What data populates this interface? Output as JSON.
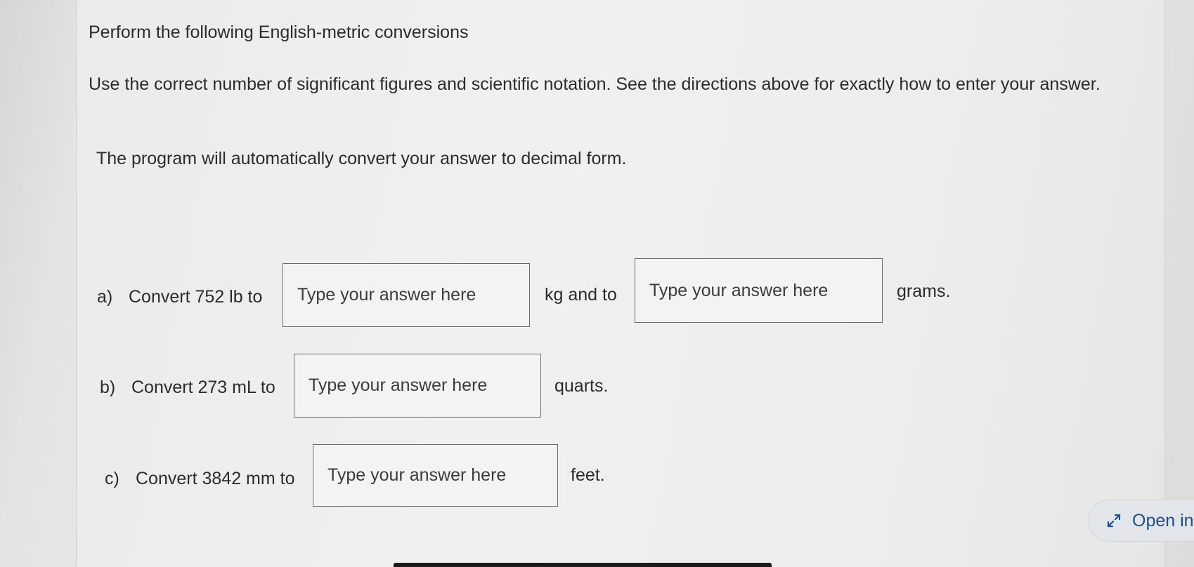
{
  "title": "Perform the following English-metric conversions",
  "instructions": {
    "line1": "Use the correct number of significant figures and scientific notation.  See the directions above for exactly how to enter your answer.",
    "line2": "The program will automatically convert your answer to decimal form."
  },
  "questions": [
    {
      "marker": "a)",
      "prompt": "Convert 752 lb to",
      "input1_placeholder": "Type your answer here",
      "middle": "kg and to",
      "input2_placeholder": "Type your answer here",
      "suffix": "grams."
    },
    {
      "marker": "b)",
      "prompt": "Convert 273 mL to",
      "input_placeholder": "Type your answer here",
      "suffix": "quarts."
    },
    {
      "marker": "c)",
      "prompt": "Convert 3842 mm to",
      "input_placeholder": "Type your answer here",
      "suffix": "feet."
    }
  ],
  "open_in": {
    "label": "Open in",
    "icon": "expand-arrows-icon",
    "color": "#1f4f8a"
  }
}
